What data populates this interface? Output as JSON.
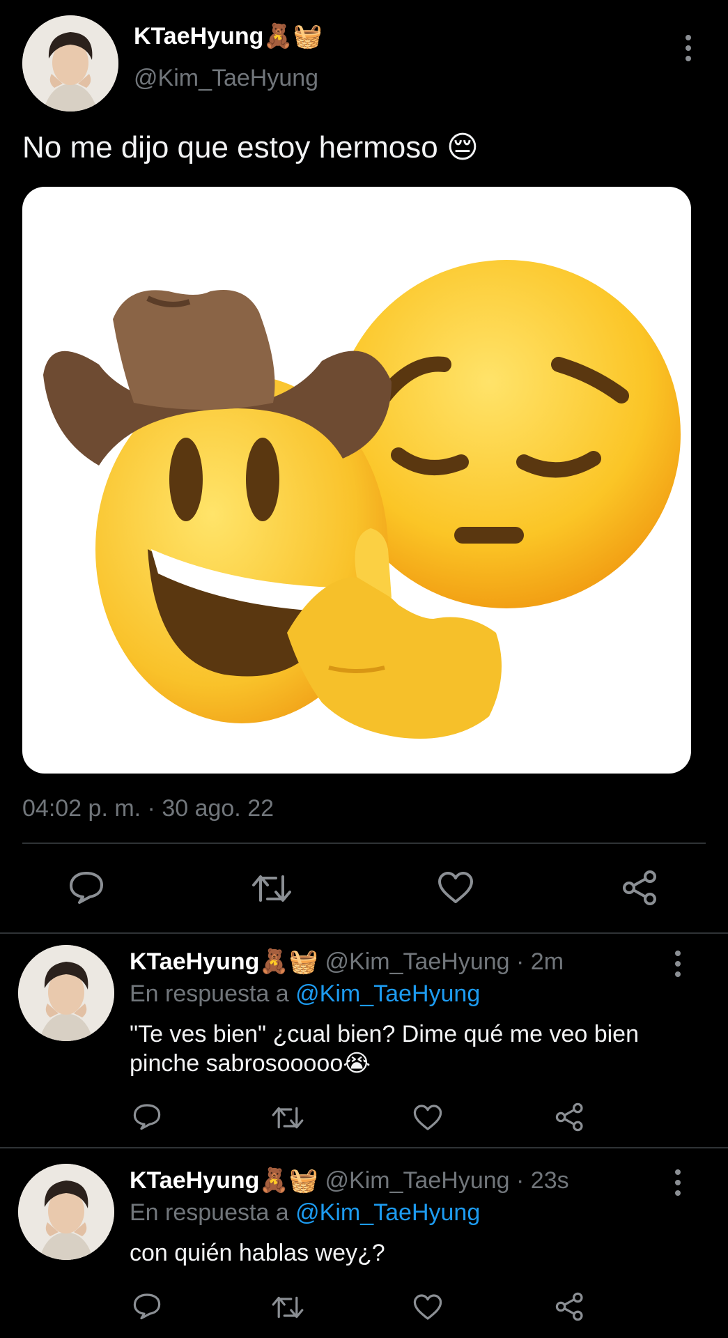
{
  "main_tweet": {
    "display_name": "KTaeHyung",
    "name_emoji": "🧸🧺",
    "handle": "@Kim_TaeHyung",
    "text": "No me dijo que estoy hermoso",
    "text_emoji": "😔",
    "timestamp": "04:02 p. m. · 30 ago. 22"
  },
  "replies": [
    {
      "display_name": "KTaeHyung",
      "name_emoji": "🧸🧺",
      "meta": "@Kim_TaeHyung · 2m",
      "reply_prefix": "En respuesta a",
      "reply_to": "@Kim_TaeHyung",
      "text_line1": "\"Te ves bien\" ¿cual bien? Dime qué me veo bien",
      "text_line2": "pinche sabrosooooo😭"
    },
    {
      "display_name": "KTaeHyung",
      "name_emoji": "🧸🧺",
      "meta": "@Kim_TaeHyung · 23s",
      "reply_prefix": "En respuesta a",
      "reply_to": "@Kim_TaeHyung",
      "text_line1": "con quién hablas wey¿?"
    }
  ],
  "icons": [
    "reply-icon",
    "retweet-icon",
    "like-icon",
    "share-icon",
    "more-options-icon"
  ],
  "colors": {
    "background": "#000000",
    "text": "#e7e9ea",
    "muted": "#71767b",
    "link": "#1d9bf0",
    "divider": "#2f3336"
  }
}
